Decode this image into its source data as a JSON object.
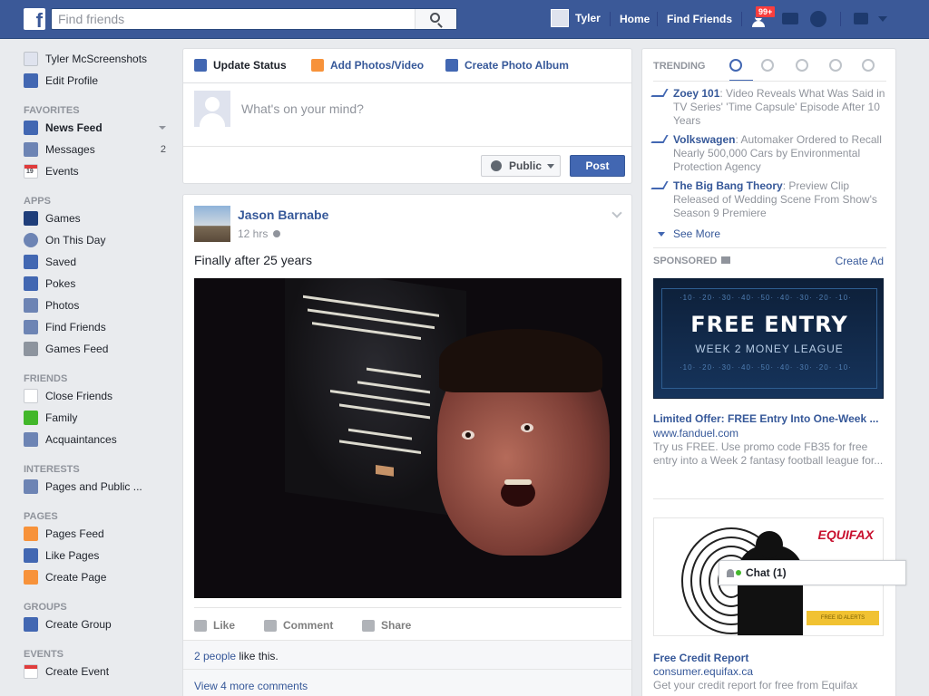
{
  "topbar": {
    "logo": "f",
    "search_placeholder": "Find friends",
    "user_name": "Tyler",
    "home": "Home",
    "find_friends": "Find Friends",
    "notif_count": "99+",
    "icons": [
      "facebook-logo",
      "search-icon",
      "friend-requests-icon",
      "messages-icon",
      "notifications-globe-icon",
      "privacy-lock-icon",
      "account-caret-icon"
    ]
  },
  "leftnav": {
    "profile_name": "Tyler McScreenshots",
    "edit_profile": "Edit Profile",
    "favorites_head": "FAVORITES",
    "news_feed": "News Feed",
    "messages": "Messages",
    "messages_count": "2",
    "events": "Events",
    "events_icon_day": "19",
    "apps_head": "APPS",
    "games": "Games",
    "on_this_day": "On This Day",
    "saved": "Saved",
    "pokes": "Pokes",
    "photos": "Photos",
    "find_friends": "Find Friends",
    "games_feed": "Games Feed",
    "friends_head": "FRIENDS",
    "close_friends": "Close Friends",
    "family": "Family",
    "acquaintances": "Acquaintances",
    "interests_head": "INTERESTS",
    "pages_public": "Pages and Public ...",
    "pages_head": "PAGES",
    "pages_feed": "Pages Feed",
    "like_pages": "Like Pages",
    "create_page": "Create Page",
    "groups_head": "GROUPS",
    "create_group": "Create Group",
    "events_head": "EVENTS",
    "create_event": "Create Event"
  },
  "composer": {
    "tab_status": "Update Status",
    "tab_photos": "Add Photos/Video",
    "tab_album": "Create Photo Album",
    "placeholder": "What's on your mind?",
    "privacy": "Public",
    "post": "Post"
  },
  "post": {
    "author": "Jason Barnabe",
    "time": "12 hrs",
    "text": "Finally after 25 years",
    "like": "Like",
    "comment": "Comment",
    "share": "Share",
    "likes_link": "2 people",
    "likes_suffix": " like this.",
    "more_comments": "View 4 more comments"
  },
  "right": {
    "trending_head": "TRENDING",
    "trends": [
      {
        "title": "Zoey 101",
        "desc": ": Video Reveals What Was Said in TV Series' 'Time Capsule' Episode After 10 Years"
      },
      {
        "title": "Volkswagen",
        "desc": ": Automaker Ordered to Recall Nearly 500,000 Cars by Environmental Protection Agency"
      },
      {
        "title": "The Big Bang Theory",
        "desc": ": Preview Clip Released of Wedding Scene From Show's Season 9 Premiere"
      }
    ],
    "see_more": "See More",
    "sponsored_head": "SPONSORED",
    "create_ad": "Create Ad",
    "ad1": {
      "image_title": "FREE ENTRY",
      "image_sub": "WEEK 2 MONEY LEAGUE",
      "yard_top": "·10· ·20· ·30· ·40· ·50· ·40· ·30· ·20· ·10·",
      "yard_bottom": "·10· ·20· ·30· ·40· ·50· ·40· ·30· ·20· ·10·",
      "title": "Limited Offer: FREE Entry Into One-Week ...",
      "url": "www.fanduel.com",
      "desc": "Try us FREE. Use promo code FB35 for free entry into a Week 2 fantasy football league for..."
    },
    "ad2": {
      "logo": "EQUIFAX",
      "image_btn": "FREE ID ALERTS",
      "title": "Free Credit Report",
      "url": "consumer.equifax.ca",
      "desc": "Get your credit report for free from Equifax"
    }
  },
  "chat": {
    "label": "Chat (1)"
  },
  "colors": {
    "brand": "#3b5998",
    "link": "#365899",
    "button": "#4267b2"
  }
}
